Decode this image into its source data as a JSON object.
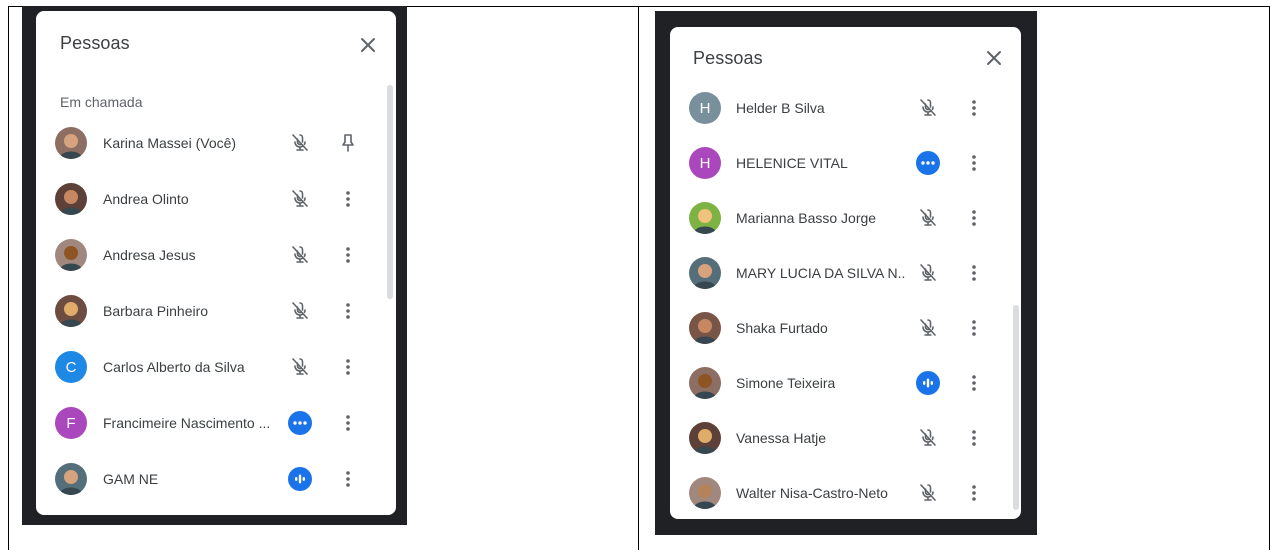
{
  "left_panel": {
    "title": "Pessoas",
    "section_label": "Em chamada",
    "people": [
      {
        "name": "Karina Massei (Você)",
        "avatar_type": "photo",
        "status": "muted",
        "action": "pin"
      },
      {
        "name": "Andrea Olinto",
        "avatar_type": "photo",
        "status": "muted",
        "action": "more"
      },
      {
        "name": "Andresa Jesus",
        "avatar_type": "photo",
        "status": "muted",
        "action": "more"
      },
      {
        "name": "Barbara Pinheiro",
        "avatar_type": "photo",
        "status": "muted",
        "action": "more"
      },
      {
        "name": "Carlos Alberto da Silva",
        "avatar_type": "letter",
        "initial": "C",
        "avatar_color": "#1e88e5",
        "status": "muted",
        "action": "more"
      },
      {
        "name": "Francimeire Nascimento ...",
        "avatar_type": "letter",
        "initial": "F",
        "avatar_color": "#ab47bc",
        "status": "idle",
        "action": "more"
      },
      {
        "name": "GAM NE",
        "avatar_type": "photo",
        "status": "speaking",
        "action": "more"
      }
    ]
  },
  "right_panel": {
    "title": "Pessoas",
    "people": [
      {
        "name": "Helder B Silva",
        "avatar_type": "letter",
        "initial": "H",
        "avatar_color": "#78909c",
        "status": "muted",
        "action": "more"
      },
      {
        "name": "HELENICE VITAL",
        "avatar_type": "letter",
        "initial": "H",
        "avatar_color": "#ab47bc",
        "status": "idle",
        "action": "more"
      },
      {
        "name": "Marianna Basso Jorge",
        "avatar_type": "photo",
        "status": "muted",
        "action": "more"
      },
      {
        "name": "MARY LUCIA DA SILVA N...",
        "avatar_type": "photo",
        "status": "muted",
        "action": "more"
      },
      {
        "name": "Shaka Furtado",
        "avatar_type": "photo",
        "status": "muted",
        "action": "more"
      },
      {
        "name": "Simone Teixeira",
        "avatar_type": "photo",
        "status": "speaking",
        "action": "more"
      },
      {
        "name": "Vanessa Hatje",
        "avatar_type": "photo",
        "status": "muted",
        "action": "more"
      },
      {
        "name": "Walter Nisa-Castro-Neto",
        "avatar_type": "photo",
        "status": "muted",
        "action": "more"
      }
    ]
  },
  "icons": {
    "close": "close-icon",
    "muted": "mic-off-icon",
    "idle": "more-horiz-status-icon",
    "speaking": "audio-level-icon",
    "pin": "pin-icon",
    "more": "more-vert-icon"
  },
  "colors": {
    "accent_blue": "#1a73e8",
    "frame_dark": "#202124",
    "text_primary": "#3c4043",
    "text_secondary": "#5f6368",
    "icon_gray": "#5f6368"
  }
}
